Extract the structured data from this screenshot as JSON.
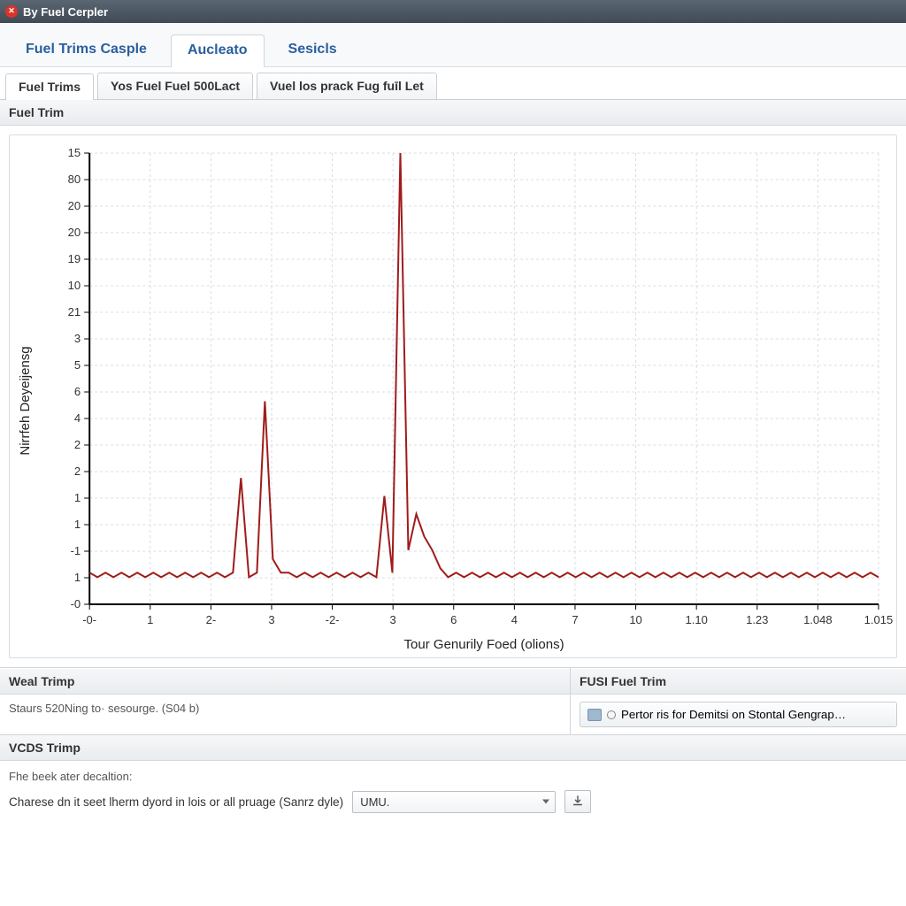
{
  "titlebar": {
    "title": "By Fuel Cerpler"
  },
  "primary_tabs": {
    "items": [
      "Fuel Trims Casple",
      "Aucleato",
      "Sesicls"
    ],
    "active_index": 1
  },
  "secondary_tabs": {
    "items": [
      "Fuel Trims",
      "Yos Fuel Fuel 500Lact",
      "Vuel los prack Fug fuīl Let"
    ],
    "active_index": 0
  },
  "section_header": "Fuel Trim",
  "chart": {
    "ylabel": "Nirrfeh Deyeijensg",
    "xlabel": "Tour Genurily Foed (olions)",
    "y_ticks": [
      "15",
      "80",
      "20",
      "20",
      "19",
      "10",
      "21",
      "3",
      "5",
      "6",
      "4",
      "2",
      "2",
      "1",
      "1",
      "-1",
      "1",
      "-0"
    ],
    "x_ticks": [
      "-0-",
      "1",
      "2-",
      "3",
      "-2-",
      "3",
      "6",
      "4",
      "7",
      "10",
      "1.10",
      "1.23",
      "1.048",
      "1.015"
    ]
  },
  "panels": {
    "left": {
      "title": "Weal Trimp",
      "body": "Staurs 520Ning to· sesourge. (S04 b)"
    },
    "right": {
      "title": "FUSI Fuel Trim",
      "button": "Pertor ris for Demitsi on Stontal Gengrap…"
    }
  },
  "vcds": {
    "title": "VCDS Trimp",
    "subtitle": "Fhe beek ater decaltion:",
    "label": "Charese dn it seet lherm dyord in lois or all pruage (Sanrz dyle)",
    "select_value": "UMU."
  },
  "chart_data": {
    "type": "line",
    "title": "Fuel Trim",
    "xlabel": "Tour Genurily Foed (olions)",
    "ylabel": "Nirrfeh Deyeijensg",
    "y_ticks_labels": [
      "15",
      "80",
      "20",
      "20",
      "19",
      "10",
      "21",
      "3",
      "5",
      "6",
      "4",
      "2",
      "2",
      "1",
      "1",
      "-1",
      "1",
      "-0"
    ],
    "x_ticks_labels": [
      "-0-",
      "1",
      "2-",
      "3",
      "-2-",
      "3",
      "6",
      "4",
      "7",
      "10",
      "1.10",
      "1.23",
      "1.048",
      "1.015"
    ],
    "ylim": [
      0,
      100
    ],
    "series": [
      {
        "name": "Fuel Trim",
        "color": "#a11b1b",
        "x": [
          0,
          1,
          2,
          3,
          4,
          5,
          6,
          7,
          8,
          9,
          10,
          11,
          12,
          13,
          14,
          15,
          16,
          17,
          18,
          19,
          20,
          21,
          22,
          23,
          24,
          25,
          26,
          27,
          28,
          29,
          30,
          31,
          32,
          33,
          34,
          35,
          36,
          37,
          38,
          39,
          40,
          41,
          42,
          43,
          44,
          45,
          46,
          47,
          48,
          49,
          50,
          51,
          52,
          53,
          54,
          55,
          56,
          57,
          58,
          59,
          60,
          61,
          62,
          63,
          64,
          65,
          66,
          67,
          68,
          69,
          70,
          71,
          72,
          73,
          74,
          75,
          76,
          77,
          78,
          79,
          80,
          81,
          82,
          83,
          84,
          85,
          86,
          87,
          88,
          89,
          90,
          91,
          92,
          93,
          94,
          95,
          96,
          97,
          98,
          99
        ],
        "values_0_100": [
          7,
          6,
          7,
          6,
          7,
          6,
          7,
          6,
          7,
          6,
          7,
          6,
          7,
          6,
          7,
          6,
          7,
          6,
          7,
          28,
          6,
          7,
          45,
          10,
          7,
          7,
          6,
          7,
          6,
          7,
          6,
          7,
          6,
          7,
          6,
          7,
          6,
          24,
          7,
          100,
          12,
          20,
          15,
          12,
          8,
          6,
          7,
          6,
          7,
          6,
          7,
          6,
          7,
          6,
          7,
          6,
          7,
          6,
          7,
          6,
          7,
          6,
          7,
          6,
          7,
          6,
          7,
          6,
          7,
          6,
          7,
          6,
          7,
          6,
          7,
          6,
          7,
          6,
          7,
          6,
          7,
          6,
          7,
          6,
          7,
          6,
          7,
          6,
          7,
          6,
          7,
          6,
          7,
          6,
          7,
          6,
          7,
          6,
          7,
          6
        ]
      }
    ],
    "peaks_note": "Two narrow peak clusters: one near x-index ~19-23 (medium height ~45%), one near x-index ~37-44 (tall spike ~100%). Baseline hovers ~6-7% with small noise."
  }
}
